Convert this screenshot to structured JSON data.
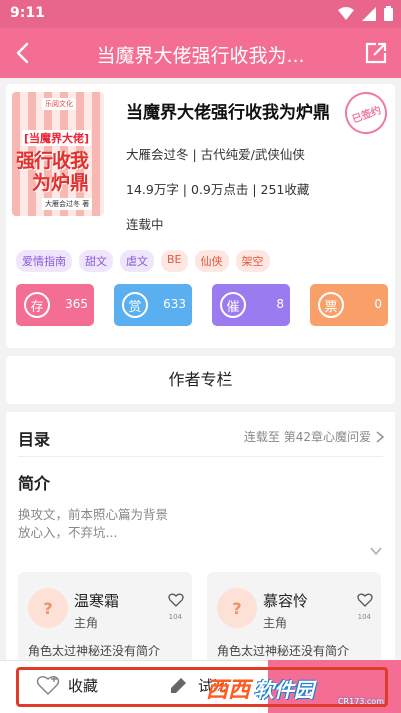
{
  "status_bar": {
    "time": "9:11"
  },
  "app_bar": {
    "title": "当魔界大佬强行收我为..."
  },
  "book": {
    "cover": {
      "publisher": "乐阅文化",
      "line1": "[当魔界大佬]",
      "line2": "强行收我",
      "line3": "为炉鼎",
      "author_tag": "大雁会过冬 著"
    },
    "title": "当魔界大佬强行收我为炉鼎",
    "stamp": "已签约",
    "meta": "大雁会过冬 | 古代纯爱/武侠仙侠",
    "stats_line": "14.9万字 | 0.9万点击 | 251收藏",
    "status": "连载中",
    "tags": [
      {
        "label": "爱情指南",
        "color": "#8a5ad8",
        "bg": "#efe6fb"
      },
      {
        "label": "甜文",
        "color": "#8a5ad8",
        "bg": "#efe6fb"
      },
      {
        "label": "虐文",
        "color": "#8a5ad8",
        "bg": "#efe6fb"
      },
      {
        "label": "BE",
        "color": "#e3573b",
        "bg": "#fde7e2"
      },
      {
        "label": "仙侠",
        "color": "#e3573b",
        "bg": "#fde7e2"
      },
      {
        "label": "架空",
        "color": "#e3573b",
        "bg": "#fde7e2"
      }
    ],
    "counters": [
      {
        "glyph": "存",
        "value": "365",
        "color": "#f46d93"
      },
      {
        "glyph": "赏",
        "value": "633",
        "color": "#5aaff0"
      },
      {
        "glyph": "催",
        "value": "8",
        "color": "#9b7cf0"
      },
      {
        "glyph": "票",
        "value": "0",
        "color": "#f9a06a"
      }
    ]
  },
  "author_column": {
    "label": "作者专栏"
  },
  "toc": {
    "title": "目录",
    "status": "连载至 第42章心魔问爱"
  },
  "intro": {
    "title": "简介",
    "line1": "换攻文，前本照心篇为背景",
    "line2": "放心入，不弃坑..."
  },
  "characters": [
    {
      "name": "温寒霜",
      "role": "主角",
      "likes": "104",
      "desc": "角色太过神秘还没有简介"
    },
    {
      "name": "慕容怜",
      "role": "主角",
      "likes": "104",
      "desc": "角色太过神秘还没有简介"
    }
  ],
  "bottom": {
    "favorite_label": "收藏",
    "read_label": "试阅"
  },
  "watermark": {
    "logo_a": "西西",
    "logo_b": "软件园",
    "site": "CR173.com"
  },
  "colors": {
    "primary": "#f46d93",
    "status_bar": "#e8668c"
  }
}
